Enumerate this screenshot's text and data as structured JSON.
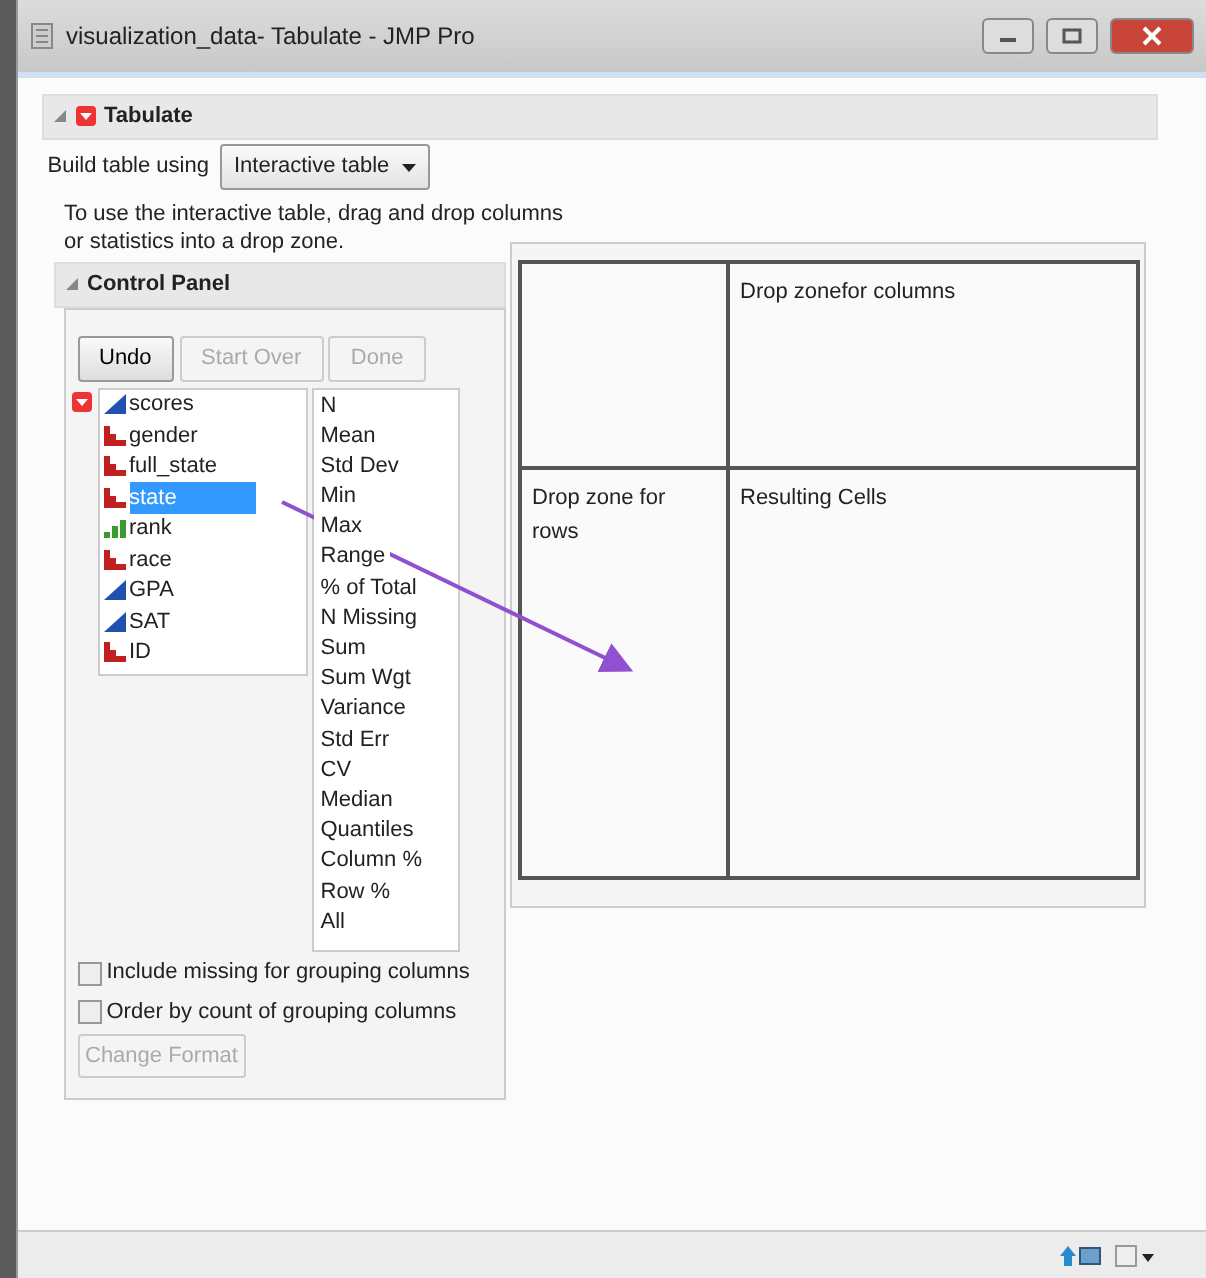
{
  "window": {
    "title": "visualization_data- Tabulate - JMP Pro"
  },
  "report": {
    "title": "Tabulate",
    "expanded": true
  },
  "build": {
    "label": "Build table using",
    "value": "Interactive table"
  },
  "instructions": "To use the interactive table, drag and drop columns or statistics into a drop zone.",
  "control_panel": {
    "title": "Control Panel",
    "expanded": true,
    "buttons": [
      {
        "label": "Undo",
        "disabled": false
      },
      {
        "label": "Start Over",
        "disabled": true
      },
      {
        "label": "Done",
        "disabled": true
      }
    ],
    "columns": [
      {
        "name": "scores",
        "kind": "continuous",
        "selected": false
      },
      {
        "name": "gender",
        "kind": "nominal",
        "selected": false
      },
      {
        "name": "full_state",
        "kind": "nominal",
        "selected": false
      },
      {
        "name": "state",
        "kind": "nominal",
        "selected": true
      },
      {
        "name": "rank",
        "kind": "ordinal",
        "selected": false
      },
      {
        "name": "race",
        "kind": "nominal",
        "selected": false
      },
      {
        "name": "GPA",
        "kind": "continuous",
        "selected": false
      },
      {
        "name": "SAT",
        "kind": "continuous",
        "selected": false
      },
      {
        "name": "ID",
        "kind": "nominal",
        "selected": false
      }
    ],
    "statistics": [
      "N",
      "Mean",
      "Std Dev",
      "Min",
      "Max",
      "Range",
      "% of Total",
      "N Missing",
      "Sum",
      "Sum Wgt",
      "Variance",
      "Std Err",
      "CV",
      "Median",
      "Quantiles",
      "Column %",
      "Row %",
      "All"
    ],
    "options": [
      {
        "label": "Include missing for grouping columns",
        "checked": false
      },
      {
        "label": "Order by count of grouping columns",
        "checked": false
      }
    ],
    "format_button": {
      "label": "Change Format",
      "disabled": true
    }
  },
  "drop_zones": {
    "columns": "Drop zonefor columns",
    "rows": "Drop zone for rows",
    "cells": "Resulting Cells"
  }
}
